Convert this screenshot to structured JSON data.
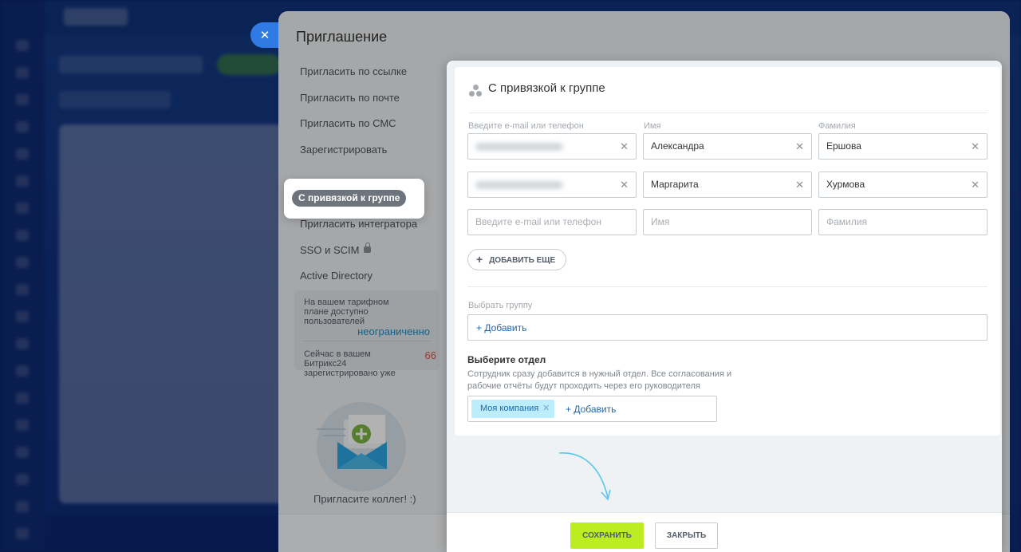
{
  "panel": {
    "title": "Приглашение",
    "close_icon": "close-icon"
  },
  "side_menu": {
    "items": [
      "Пригласить по ссылке",
      "Пригласить по почте",
      "Пригласить по СМС",
      "Зарегистрировать",
      "",
      "Пригласить интегратора",
      "SSO и SCIM",
      "Active Directory"
    ],
    "active_label": "С привязкой к группе"
  },
  "tariff": {
    "available_text": "На вашем тарифном плане доступно пользователей",
    "available_value": "неограниченно",
    "registered_text": "Сейчас в вашем Битрикс24 зарегистрировано уже",
    "registered_value": "66"
  },
  "invite_text": "Пригласите коллег! :)",
  "form": {
    "title": "С привязкой к группе",
    "labels": {
      "email": "Введите e-mail или телефон",
      "name": "Имя",
      "surname": "Фамилия"
    },
    "rows": [
      {
        "name": "Александра",
        "surname": "Ершова"
      },
      {
        "name": "Маргарита",
        "surname": "Хурмова"
      }
    ],
    "placeholders": {
      "email": "Введите e-mail или телефон",
      "name": "Имя",
      "surname": "Фамилия"
    },
    "add_more": "ДОБАВИТЬ ЕЩЕ",
    "group_label": "Выбрать группу",
    "add_link": "+ Добавить",
    "dept_title": "Выберите отдел",
    "dept_desc": "Сотрудник сразу добавится в нужный отдел. Все согласования и рабочие отчёты будут проходить через его руководителя",
    "dept_tag": "Моя компания",
    "save": "СОХРАНИТЬ",
    "close": "ЗАКРЫТЬ"
  },
  "colors": {
    "accent": "#2067b0",
    "save_button": "#bbed21",
    "tag_bg": "#bcedfc",
    "registered_value": "#e14e43",
    "available_value": "#1a8ec7",
    "arrow": "#5bc6ea"
  }
}
